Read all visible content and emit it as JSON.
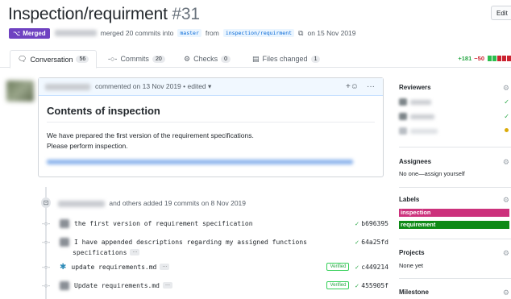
{
  "header": {
    "title": "Inspection/requirment",
    "number": "#31",
    "edit_label": "Edit"
  },
  "meta": {
    "status": "Merged",
    "text1": "merged 20 commits into",
    "base_branch": "master",
    "text2": "from",
    "head_branch": "inspection/requirment",
    "text3": "on 15 Nov 2019"
  },
  "tabs": [
    {
      "label": "Conversation",
      "count": "56"
    },
    {
      "label": "Commits",
      "count": "20"
    },
    {
      "label": "Checks",
      "count": "0"
    },
    {
      "label": "Files changed",
      "count": "1"
    }
  ],
  "diffstat": {
    "additions": "+181",
    "deletions": "−50"
  },
  "comment": {
    "header_text": "commented on 13 Nov 2019 • edited ▾",
    "title": "Contents of inspection",
    "line1": "We have prepared the first version of the requirement specifications.",
    "line2": "Please perform inspection."
  },
  "event": {
    "text": "and others added 19 commits on 8 Nov 2019"
  },
  "commits": [
    {
      "msg": "the first version of requirement specification",
      "msg2": "",
      "verified": "",
      "sha": "b696395"
    },
    {
      "msg": "I have appended descriptions regarding my assigned functions",
      "msg2": "specifications",
      "verified": "",
      "sha": "64a25fd"
    },
    {
      "msg": "update requirements.md",
      "msg2": "",
      "verified": "Verified",
      "sha": "c449214"
    },
    {
      "msg": "Update requirements.md",
      "msg2": "",
      "verified": "Verified",
      "sha": "455905f"
    }
  ],
  "sidebar": {
    "reviewers_title": "Reviewers",
    "assignees_title": "Assignees",
    "assignees_value": "No one—assign yourself",
    "labels_title": "Labels",
    "labels": [
      {
        "name": "inspection",
        "color": "#cc317c"
      },
      {
        "name": "requirement",
        "color": "#0e8a16"
      }
    ],
    "projects_title": "Projects",
    "projects_value": "None yet",
    "milestone_title": "Milestone"
  },
  "colors": {
    "merged": "#6f42c1",
    "link": "#0366d6",
    "success": "#28a745"
  }
}
